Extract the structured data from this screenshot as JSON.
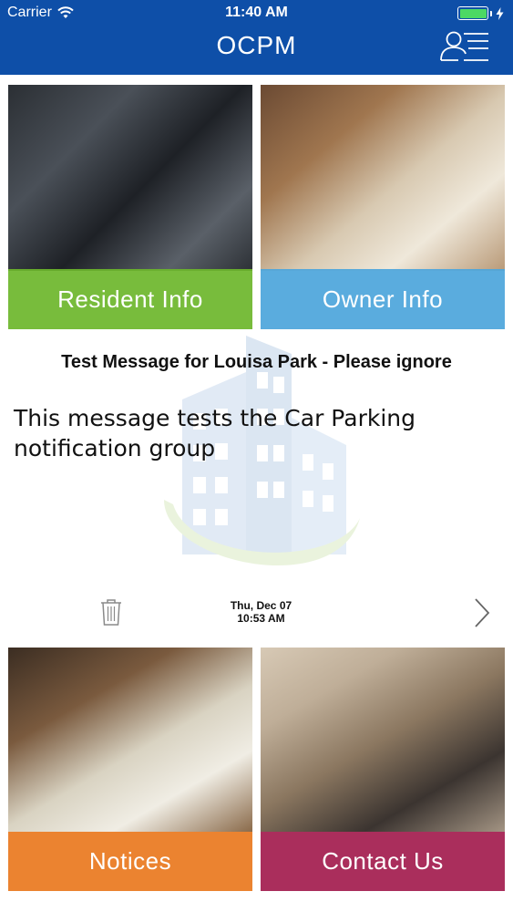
{
  "status_bar": {
    "carrier": "Carrier",
    "time": "11:40 AM",
    "battery_color": "#4cd964"
  },
  "header": {
    "title": "OCPM",
    "profile_icon": "profile-menu-icon",
    "background_color": "#0e4fa8"
  },
  "tiles": {
    "resident": {
      "label": "Resident Info",
      "color": "#6cb62b"
    },
    "owner": {
      "label": "Owner Info",
      "color": "#4ea6db"
    },
    "notices": {
      "label": "Notices",
      "color": "#e97a20"
    },
    "contact": {
      "label": "Contact Us",
      "color": "#a41e50"
    }
  },
  "message": {
    "title": "Test Message for Louisa Park - Please ignore",
    "body": "This message tests the Car Parking notification group",
    "date": "Thu, Dec 07",
    "time": "10:53 AM",
    "delete_icon": "trash-icon",
    "next_icon": "chevron-right-icon"
  }
}
